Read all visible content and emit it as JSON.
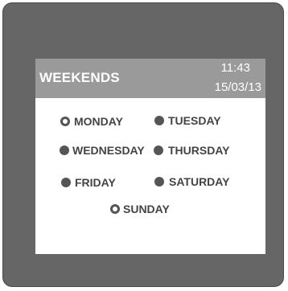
{
  "header": {
    "title": "WEEKENDS",
    "time": "11:43",
    "date": "15/03/13"
  },
  "days": [
    {
      "label": "MONDAY",
      "selected": false
    },
    {
      "label": "TUESDAY",
      "selected": true
    },
    {
      "label": "WEDNESDAY",
      "selected": true
    },
    {
      "label": "THURSDAY",
      "selected": true
    },
    {
      "label": "FRIDAY",
      "selected": true
    },
    {
      "label": "SATURDAY",
      "selected": true
    },
    {
      "label": "SUNDAY",
      "selected": false
    }
  ],
  "colors": {
    "bezel": "#666666",
    "header_bg": "#9a9a9a",
    "radio": "#555555"
  }
}
